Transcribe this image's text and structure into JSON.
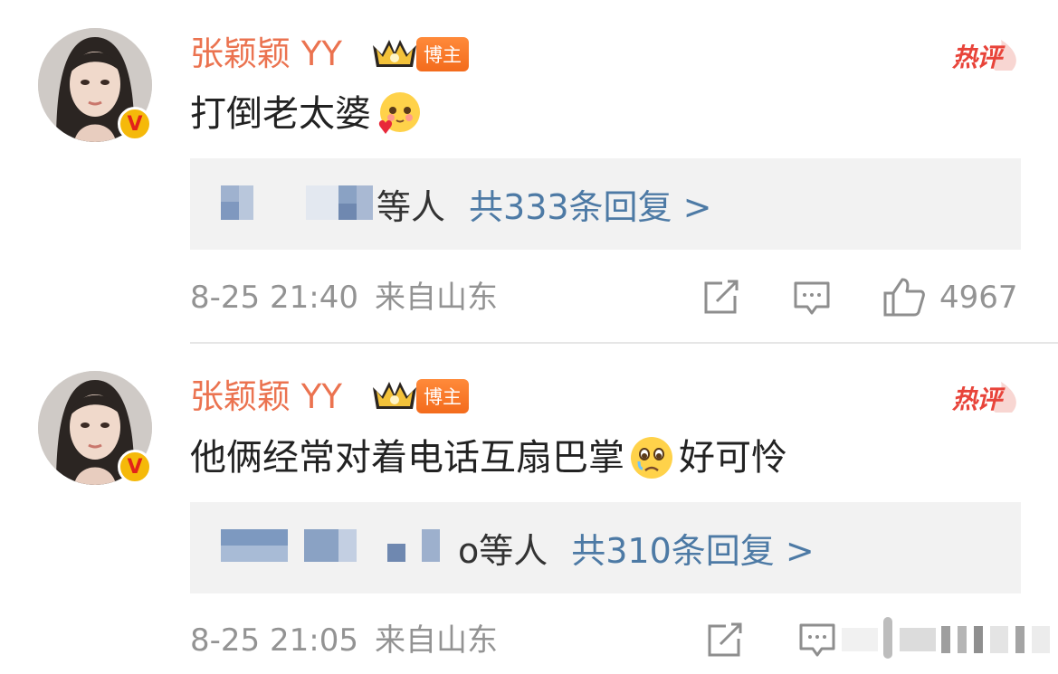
{
  "comments": [
    {
      "username": "张颖颖 YY",
      "blogger_tag": "博主",
      "hot_label": "热评",
      "text_before_emoji": "打倒老太婆",
      "text_after_emoji": "",
      "emoji": "blush-heart-emoji",
      "reply_who": "等人",
      "reply_link": "共333条回复 >",
      "date": "8-25 21:40",
      "source": "来自山东",
      "like_count": "4967"
    },
    {
      "username": "张颖颖 YY",
      "blogger_tag": "博主",
      "hot_label": "热评",
      "text_before_emoji": "他俩经常对着电话互扇巴掌",
      "text_after_emoji": "好可怜",
      "emoji": "crying-sad-emoji",
      "reply_who": "o等人",
      "reply_link": "共310条回复 >",
      "date": "8-25 21:05",
      "source": "来自山东",
      "like_count": ""
    }
  ],
  "colors": {
    "username": "#eb7350",
    "link": "#4d7aa5",
    "meta": "#939393",
    "hot": "#e8443a",
    "reply_bg": "#f2f2f2"
  }
}
